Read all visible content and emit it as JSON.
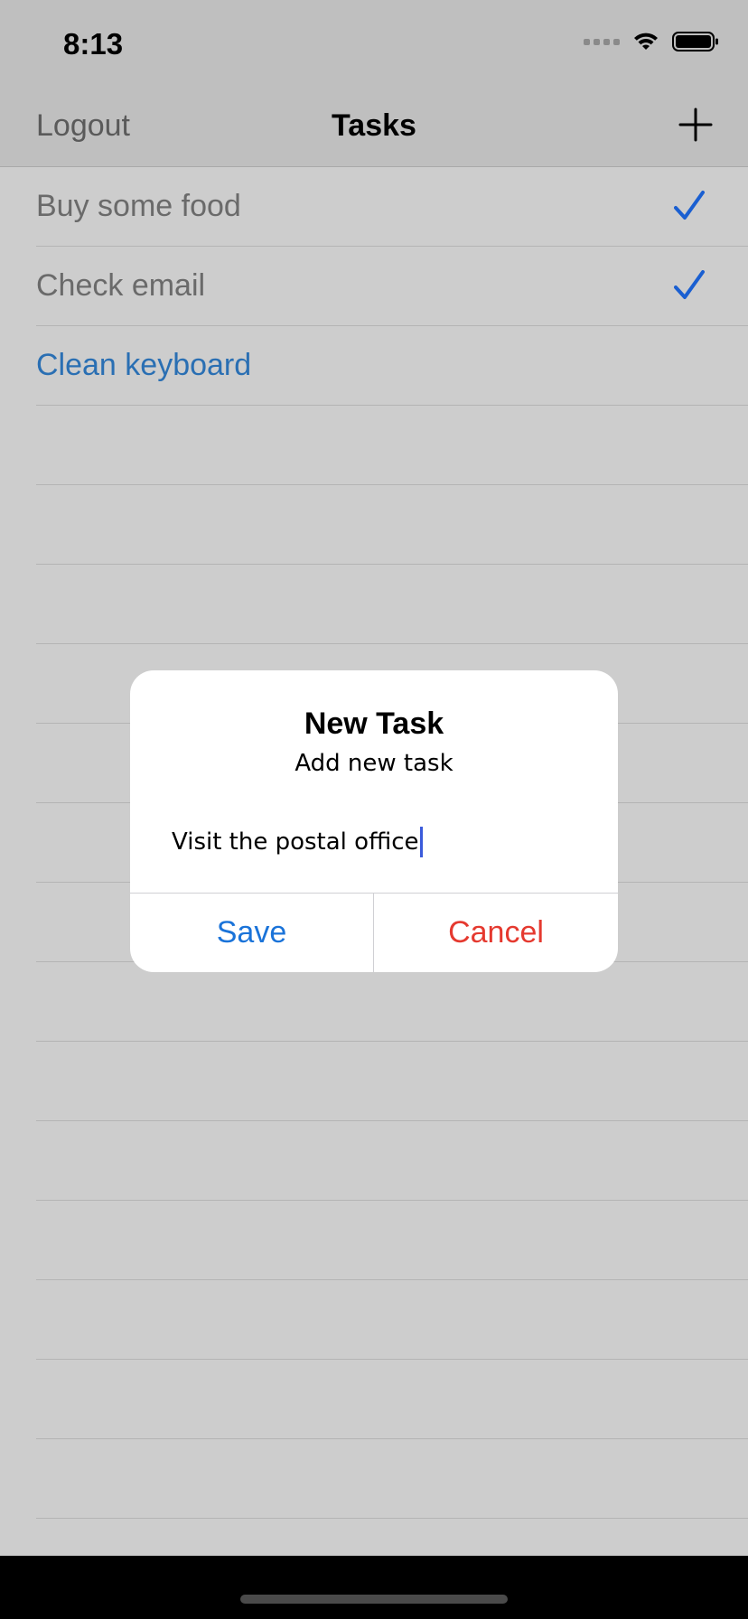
{
  "status_bar": {
    "time": "8:13"
  },
  "nav": {
    "logout_label": "Logout",
    "title": "Tasks",
    "add_icon": "plus-icon"
  },
  "tasks": [
    {
      "label": "Buy some food",
      "checked": true
    },
    {
      "label": "Check email",
      "checked": true
    },
    {
      "label": "Clean keyboard",
      "checked": false
    }
  ],
  "alert": {
    "title": "New Task",
    "message": "Add new task",
    "field_value": "Visit the postal office",
    "save_label": "Save",
    "cancel_label": "Cancel"
  },
  "colors": {
    "accent": "#1a73d9",
    "destructive": "#e5392f",
    "checkmark": "#1a5fd1"
  }
}
